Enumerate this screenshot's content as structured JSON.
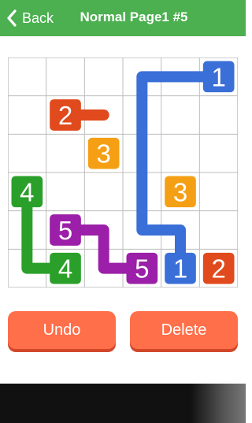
{
  "header": {
    "back_label": "Back",
    "title": "Normal Page1 #5"
  },
  "board": {
    "rows": 6,
    "cols": 6,
    "grid_line_color": "#bdbdbd",
    "cells": [
      {
        "row": 0,
        "col": 5,
        "value": "1",
        "color": "#3a6fd8"
      },
      {
        "row": 5,
        "col": 4,
        "value": "1",
        "color": "#3a6fd8"
      },
      {
        "row": 1,
        "col": 1,
        "value": "2",
        "color": "#e04a1c"
      },
      {
        "row": 5,
        "col": 5,
        "value": "2",
        "color": "#e04a1c"
      },
      {
        "row": 2,
        "col": 2,
        "value": "3",
        "color": "#f5a014"
      },
      {
        "row": 3,
        "col": 4,
        "value": "3",
        "color": "#f5a014"
      },
      {
        "row": 3,
        "col": 0,
        "value": "4",
        "color": "#2aa02a"
      },
      {
        "row": 5,
        "col": 1,
        "value": "4",
        "color": "#2aa02a"
      },
      {
        "row": 4,
        "col": 1,
        "value": "5",
        "color": "#9b1fa8"
      },
      {
        "row": 5,
        "col": 3,
        "value": "5",
        "color": "#9b1fa8"
      }
    ],
    "paths": [
      {
        "color": "#3a6fd8",
        "cells": [
          [
            0,
            5
          ],
          [
            0,
            4
          ],
          [
            0,
            3
          ],
          [
            1,
            3
          ],
          [
            2,
            3
          ],
          [
            3,
            3
          ],
          [
            4,
            3
          ],
          [
            4,
            4
          ],
          [
            5,
            4
          ]
        ]
      },
      {
        "color": "#e04a1c",
        "cells": [
          [
            1,
            1
          ],
          [
            1,
            2
          ]
        ]
      },
      {
        "color": "#2aa02a",
        "cells": [
          [
            3,
            0
          ],
          [
            4,
            0
          ],
          [
            5,
            0
          ],
          [
            5,
            1
          ]
        ]
      },
      {
        "color": "#9b1fa8",
        "cells": [
          [
            4,
            1
          ],
          [
            4,
            2
          ],
          [
            5,
            2
          ],
          [
            5,
            3
          ]
        ]
      }
    ]
  },
  "buttons": {
    "undo_label": "Undo",
    "delete_label": "Delete"
  }
}
